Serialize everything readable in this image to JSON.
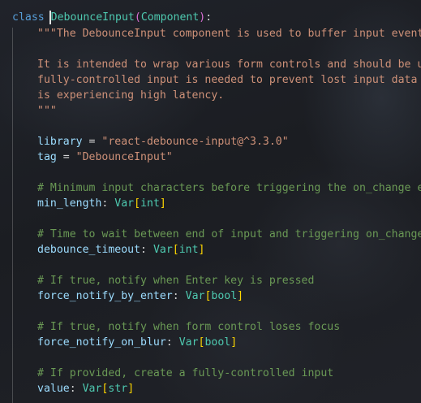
{
  "code": {
    "line1": {
      "keyword": "class",
      "class_name": "DebounceInput",
      "open_paren": "(",
      "base": "Component",
      "close_paren": ")",
      "colon": ":"
    },
    "line2": {
      "text": "\"\"\"The DebounceInput component is used to buffer input events"
    },
    "line3": {
      "text": ""
    },
    "line4": {
      "text": "It is intended to wrap various form controls and should be use"
    },
    "line5": {
      "text": "fully-controlled input is needed to prevent lost input data wh"
    },
    "line6": {
      "text": "is experiencing high latency."
    },
    "line7": {
      "text": "\"\"\""
    },
    "line8": {
      "text": ""
    },
    "line9": {
      "name": "library",
      "op": " = ",
      "value": "\"react-debounce-input@^3.3.0\""
    },
    "line10": {
      "name": "tag",
      "op": " = ",
      "value": "\"DebounceInput\""
    },
    "line11": {
      "text": ""
    },
    "line12": {
      "comment": "# Minimum input characters before triggering the on_change eve"
    },
    "line13": {
      "name": "min_length",
      "colon": ": ",
      "type": "Var",
      "open": "[",
      "inner": "int",
      "close": "]"
    },
    "line14": {
      "text": ""
    },
    "line15": {
      "comment": "# Time to wait between end of input and triggering on_change"
    },
    "line16": {
      "name": "debounce_timeout",
      "colon": ": ",
      "type": "Var",
      "open": "[",
      "inner": "int",
      "close": "]"
    },
    "line17": {
      "text": ""
    },
    "line18": {
      "comment": "# If true, notify when Enter key is pressed"
    },
    "line19": {
      "name": "force_notify_by_enter",
      "colon": ": ",
      "type": "Var",
      "open": "[",
      "inner": "bool",
      "close": "]"
    },
    "line20": {
      "text": ""
    },
    "line21": {
      "comment": "# If true, notify when form control loses focus"
    },
    "line22": {
      "name": "force_notify_on_blur",
      "colon": ": ",
      "type": "Var",
      "open": "[",
      "inner": "bool",
      "close": "]"
    },
    "line23": {
      "text": ""
    },
    "line24": {
      "comment": "# If provided, create a fully-controlled input"
    },
    "line25": {
      "name": "value",
      "colon": ": ",
      "type": "Var",
      "open": "[",
      "inner": "str",
      "close": "]"
    }
  },
  "colors": {
    "keyword": "#569cd6",
    "class_name": "#4ec9b0",
    "string": "#ce9178",
    "comment": "#6a9955",
    "variable": "#9cdcfe",
    "bracket": "#ffd700",
    "paren": "#da70d6"
  }
}
